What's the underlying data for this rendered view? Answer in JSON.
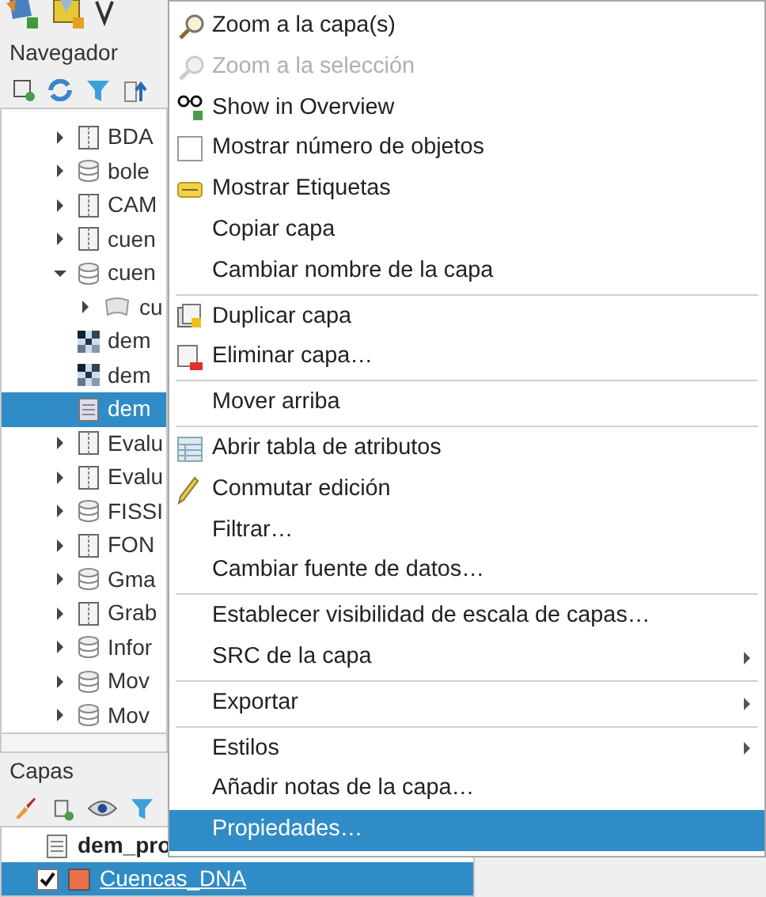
{
  "browser": {
    "title": "Navegador",
    "items": [
      {
        "label": "BDA",
        "kind": "archive",
        "expanded": false,
        "selected": false
      },
      {
        "label": "bole",
        "kind": "database",
        "expanded": false,
        "selected": false
      },
      {
        "label": "CAM",
        "kind": "archive",
        "expanded": false,
        "selected": false
      },
      {
        "label": "cuen",
        "kind": "archive",
        "expanded": false,
        "selected": false
      },
      {
        "label": "cuen",
        "kind": "database",
        "expanded": true,
        "selected": false,
        "children": [
          {
            "label": "cu",
            "kind": "polygon",
            "expanded": false,
            "selected": false
          }
        ]
      },
      {
        "label": "dem",
        "kind": "raster",
        "selected": false
      },
      {
        "label": "dem",
        "kind": "raster",
        "selected": false
      },
      {
        "label": "dem",
        "kind": "table",
        "selected": true
      },
      {
        "label": "Evalu",
        "kind": "archive",
        "expanded": false,
        "selected": false
      },
      {
        "label": "Evalu",
        "kind": "archive",
        "expanded": false,
        "selected": false
      },
      {
        "label": "FISSI",
        "kind": "database",
        "expanded": false,
        "selected": false
      },
      {
        "label": "FON",
        "kind": "archive",
        "expanded": false,
        "selected": false
      },
      {
        "label": "Gma",
        "kind": "database",
        "expanded": false,
        "selected": false
      },
      {
        "label": "Grab",
        "kind": "archive",
        "expanded": false,
        "selected": false
      },
      {
        "label": "Infor",
        "kind": "database",
        "expanded": false,
        "selected": false
      },
      {
        "label": "Mov",
        "kind": "database",
        "expanded": false,
        "selected": false
      },
      {
        "label": "Mov",
        "kind": "database",
        "expanded": false,
        "selected": false
      }
    ]
  },
  "layers": {
    "title": "Capas",
    "items": [
      {
        "label": "dem_pro",
        "kind": "table",
        "selected": false
      },
      {
        "label": "Cuencas_DNA",
        "kind": "vector",
        "checked": true,
        "color": "#e8704a",
        "selected": true
      }
    ]
  },
  "context_menu": [
    {
      "label": "Zoom a la capa(s)",
      "kind": "magnifier",
      "disabled": false,
      "selected": false
    },
    {
      "label": "Zoom a la selección",
      "kind": "magnifier",
      "disabled": true,
      "selected": false
    },
    {
      "label": "Show in Overview",
      "kind": "glasses",
      "disabled": false,
      "selected": false
    },
    {
      "label": "Mostrar número de objetos",
      "kind": "checkbox",
      "checked": false,
      "disabled": false,
      "selected": false
    },
    {
      "label": "Mostrar Etiquetas",
      "kind": "tag",
      "disabled": false,
      "selected": false
    },
    {
      "label": "Copiar capa",
      "kind": "plain",
      "disabled": false,
      "selected": false
    },
    {
      "label": "Cambiar nombre de la capa",
      "kind": "plain",
      "disabled": false,
      "selected": false,
      "separator_after": true
    },
    {
      "label": "Duplicar capa",
      "kind": "duplicate",
      "disabled": false,
      "selected": false
    },
    {
      "label": "Eliminar capa…",
      "kind": "remove",
      "disabled": false,
      "selected": false,
      "separator_after": true
    },
    {
      "label": "Mover arriba",
      "kind": "plain",
      "disabled": false,
      "selected": false,
      "separator_after": true
    },
    {
      "label": "Abrir tabla de atributos",
      "kind": "table",
      "disabled": false,
      "selected": false
    },
    {
      "label": "Conmutar edición",
      "kind": "pencil",
      "disabled": false,
      "selected": false
    },
    {
      "label": "Filtrar…",
      "kind": "plain",
      "disabled": false,
      "selected": false
    },
    {
      "label": "Cambiar fuente de datos…",
      "kind": "plain",
      "disabled": false,
      "selected": false,
      "separator_after": true
    },
    {
      "label": "Establecer visibilidad de escala de capas…",
      "kind": "plain",
      "disabled": false,
      "selected": false
    },
    {
      "label": "SRC de la capa",
      "kind": "submenu",
      "disabled": false,
      "selected": false,
      "separator_after": true
    },
    {
      "label": "Exportar",
      "kind": "submenu",
      "disabled": false,
      "selected": false,
      "separator_after": true
    },
    {
      "label": "Estilos",
      "kind": "submenu",
      "disabled": false,
      "selected": false
    },
    {
      "label": "Añadir notas de la capa…",
      "kind": "plain",
      "disabled": false,
      "selected": false
    },
    {
      "label": "Propiedades…",
      "kind": "plain",
      "disabled": false,
      "selected": true
    }
  ]
}
